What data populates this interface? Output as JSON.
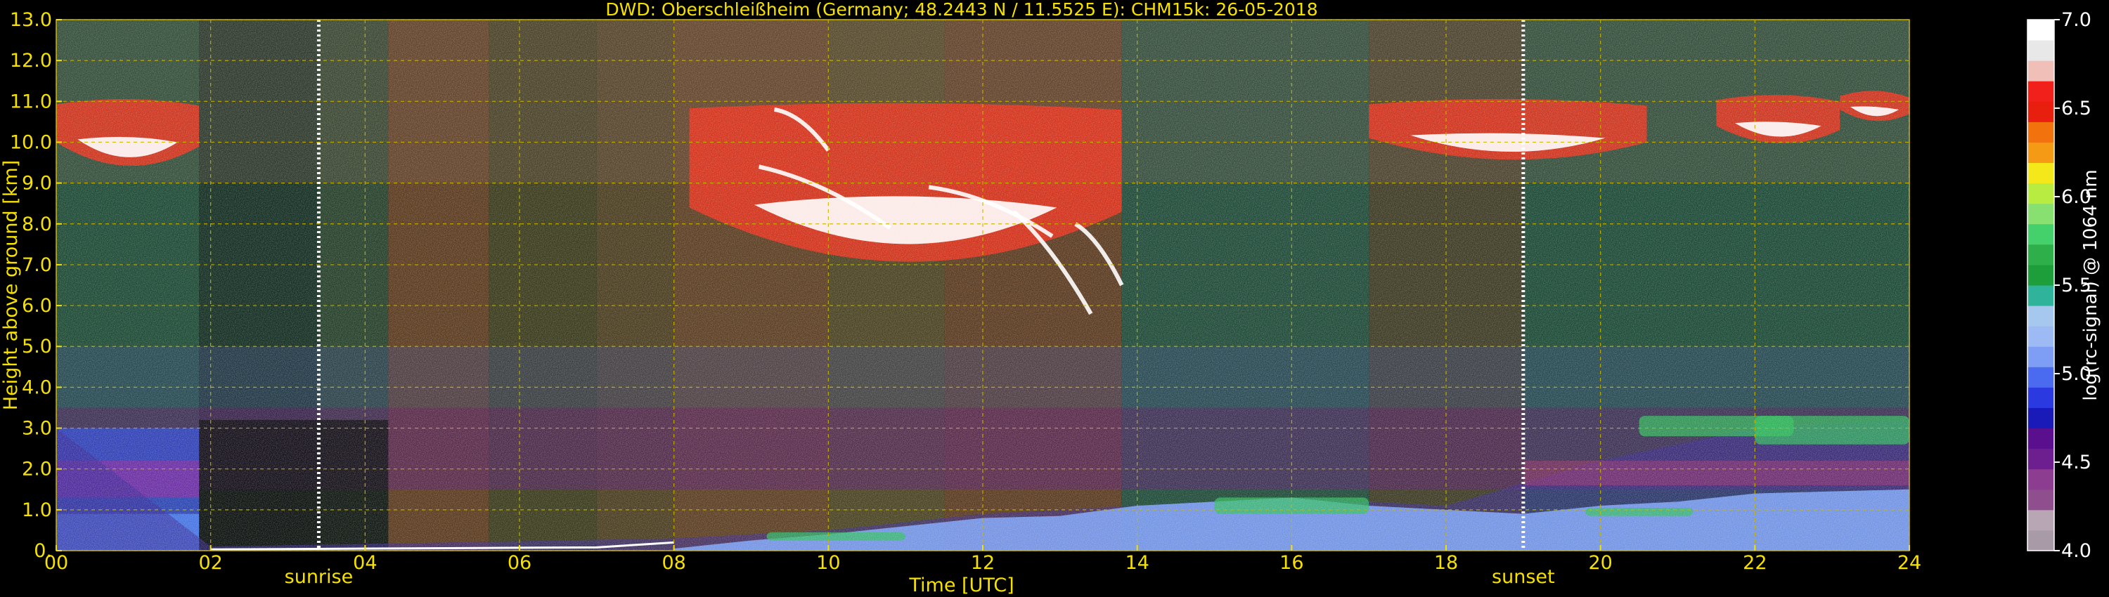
{
  "chart_data": {
    "type": "heatmap",
    "title": "DWD: Oberschleißheim (Germany; 48.2443 N / 11.5525 E):    CHM15k: 26-05-2018",
    "xlabel": "Time [UTC]",
    "ylabel": "Height above ground [km]",
    "colorbar_label": "log(rc-signal) @ 1064 nm",
    "xlim": [
      0,
      24
    ],
    "ylim": [
      0,
      13
    ],
    "clim": [
      4.0,
      7.0
    ],
    "x_ticks": [
      0,
      2,
      4,
      6,
      8,
      10,
      12,
      14,
      16,
      18,
      20,
      22,
      24
    ],
    "x_tick_labels": [
      "00",
      "02",
      "04",
      "06",
      "08",
      "10",
      "12",
      "14",
      "16",
      "18",
      "20",
      "22",
      "24"
    ],
    "y_ticks": [
      0,
      1,
      2,
      3,
      4,
      5,
      6,
      7,
      8,
      9,
      10,
      11,
      12,
      13
    ],
    "y_tick_labels": [
      "0.",
      "1.0",
      "2.0",
      "3.0",
      "4.0",
      "5.0",
      "6.0",
      "7.0",
      "8.0",
      "9.0",
      "10.0",
      "11.0",
      "12.0",
      "13.0"
    ],
    "colorbar_ticks": [
      4.0,
      4.5,
      5.0,
      5.5,
      6.0,
      6.5,
      7.0
    ],
    "colorbar_tick_labels": [
      "4.0",
      "4.5",
      "5.0",
      "5.5",
      "6.0",
      "6.5",
      "7.0"
    ],
    "grid": true,
    "annotations": [
      {
        "label": "sunrise",
        "time": 3.4
      },
      {
        "label": "sunset",
        "time": 19.0
      }
    ],
    "colormap": [
      "#a89aa6",
      "#b8a6b4",
      "#8f4e8e",
      "#8c3d90",
      "#6e1f8f",
      "#5a0f8f",
      "#1a1ab8",
      "#2a3ae0",
      "#4a6af0",
      "#7e9ef5",
      "#9ebaf5",
      "#a6c8ee",
      "#2fb39b",
      "#1e9e3a",
      "#2faf4a",
      "#44d06a",
      "#88e070",
      "#b8ec40",
      "#f5e81a",
      "#f59a14",
      "#f2720e",
      "#e81e0e",
      "#f2201a",
      "#f0c0b8",
      "#e8e8e8",
      "#ffffff"
    ],
    "colors": {
      "text": "#f5e000",
      "grid": "#c8b400",
      "background": "#000000",
      "annotation_line": "#ffffff",
      "colorbar_text": "#ffffff"
    },
    "cloud_layers": [
      {
        "t_start": 0.0,
        "t_end": 1.85,
        "h_low": 8.9,
        "h_high": 11.1
      },
      {
        "t_start": 8.2,
        "t_end": 13.8,
        "h_low": 5.8,
        "h_high": 11.0
      },
      {
        "t_start": 17.0,
        "t_end": 20.6,
        "h_low": 9.1,
        "h_high": 11.1
      },
      {
        "t_start": 21.5,
        "t_end": 23.1,
        "h_low": 9.6,
        "h_high": 11.2
      },
      {
        "t_start": 23.1,
        "t_end": 24.0,
        "h_low": 10.3,
        "h_high": 11.3
      }
    ],
    "boundary_layer_top_km": [
      {
        "t": 0,
        "h": 3.0
      },
      {
        "t": 2,
        "h": 0.1
      },
      {
        "t": 8,
        "h": 0.3
      },
      {
        "t": 10,
        "h": 0.5
      },
      {
        "t": 12,
        "h": 0.9
      },
      {
        "t": 14,
        "h": 1.1
      },
      {
        "t": 16,
        "h": 1.3
      },
      {
        "t": 18,
        "h": 1.1
      },
      {
        "t": 20,
        "h": 2.2
      },
      {
        "t": 22,
        "h": 3.0
      },
      {
        "t": 24,
        "h": 3.2
      }
    ]
  }
}
